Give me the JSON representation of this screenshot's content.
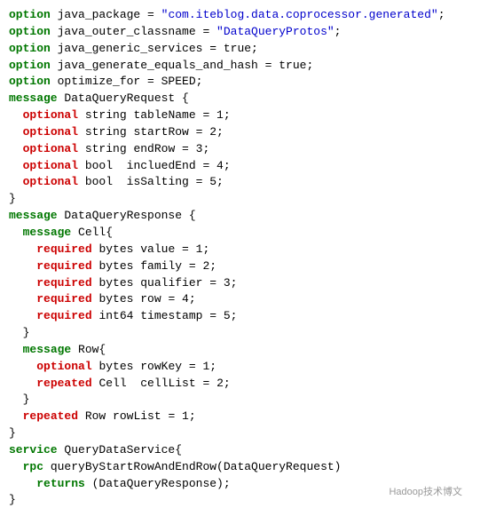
{
  "code": {
    "lines": [
      {
        "parts": [
          {
            "type": "kw-option",
            "text": "option"
          },
          {
            "type": "plain",
            "text": " java_package = "
          },
          {
            "type": "str",
            "text": "\"com.iteblog.data.coprocessor.generated\""
          },
          {
            "type": "plain",
            "text": ";"
          }
        ]
      },
      {
        "parts": [
          {
            "type": "kw-option",
            "text": "option"
          },
          {
            "type": "plain",
            "text": " java_outer_classname = "
          },
          {
            "type": "str",
            "text": "\"DataQueryProtos\""
          },
          {
            "type": "plain",
            "text": ";"
          }
        ]
      },
      {
        "parts": [
          {
            "type": "kw-option",
            "text": "option"
          },
          {
            "type": "plain",
            "text": " java_generic_services = true;"
          }
        ]
      },
      {
        "parts": [
          {
            "type": "kw-option",
            "text": "option"
          },
          {
            "type": "plain",
            "text": " java_generate_equals_and_hash = true;"
          }
        ]
      },
      {
        "parts": [
          {
            "type": "kw-option",
            "text": "option"
          },
          {
            "type": "plain",
            "text": " optimize_for = SPEED;"
          }
        ]
      },
      {
        "parts": [
          {
            "type": "kw-message",
            "text": "message"
          },
          {
            "type": "plain",
            "text": " DataQueryRequest {"
          }
        ]
      },
      {
        "parts": [
          {
            "type": "plain",
            "text": "  "
          },
          {
            "type": "kw-optional",
            "text": "optional"
          },
          {
            "type": "plain",
            "text": " string tableName = 1;"
          }
        ]
      },
      {
        "parts": [
          {
            "type": "plain",
            "text": "  "
          },
          {
            "type": "kw-optional",
            "text": "optional"
          },
          {
            "type": "plain",
            "text": " string startRow = 2;"
          }
        ]
      },
      {
        "parts": [
          {
            "type": "plain",
            "text": "  "
          },
          {
            "type": "kw-optional",
            "text": "optional"
          },
          {
            "type": "plain",
            "text": " string endRow = 3;"
          }
        ]
      },
      {
        "parts": [
          {
            "type": "plain",
            "text": "  "
          },
          {
            "type": "kw-optional",
            "text": "optional"
          },
          {
            "type": "plain",
            "text": " bool  incluedEnd = 4;"
          }
        ]
      },
      {
        "parts": [
          {
            "type": "plain",
            "text": "  "
          },
          {
            "type": "kw-optional",
            "text": "optional"
          },
          {
            "type": "plain",
            "text": " bool  isSalting = 5;"
          }
        ]
      },
      {
        "parts": [
          {
            "type": "plain",
            "text": "}"
          }
        ]
      },
      {
        "parts": [
          {
            "type": "kw-message",
            "text": "message"
          },
          {
            "type": "plain",
            "text": " DataQueryResponse {"
          }
        ]
      },
      {
        "parts": [
          {
            "type": "plain",
            "text": "  "
          },
          {
            "type": "kw-message",
            "text": "message"
          },
          {
            "type": "plain",
            "text": " Cell{"
          }
        ]
      },
      {
        "parts": [
          {
            "type": "plain",
            "text": "    "
          },
          {
            "type": "kw-required",
            "text": "required"
          },
          {
            "type": "plain",
            "text": " bytes value = 1;"
          }
        ]
      },
      {
        "parts": [
          {
            "type": "plain",
            "text": "    "
          },
          {
            "type": "kw-required",
            "text": "required"
          },
          {
            "type": "plain",
            "text": " bytes family = 2;"
          }
        ]
      },
      {
        "parts": [
          {
            "type": "plain",
            "text": "    "
          },
          {
            "type": "kw-required",
            "text": "required"
          },
          {
            "type": "plain",
            "text": " bytes qualifier = 3;"
          }
        ]
      },
      {
        "parts": [
          {
            "type": "plain",
            "text": "    "
          },
          {
            "type": "kw-required",
            "text": "required"
          },
          {
            "type": "plain",
            "text": " bytes row = 4;"
          }
        ]
      },
      {
        "parts": [
          {
            "type": "plain",
            "text": "    "
          },
          {
            "type": "kw-required",
            "text": "required"
          },
          {
            "type": "plain",
            "text": " int64 timestamp = 5;"
          }
        ]
      },
      {
        "parts": [
          {
            "type": "plain",
            "text": "  }"
          }
        ]
      },
      {
        "parts": [
          {
            "type": "plain",
            "text": "  "
          },
          {
            "type": "kw-message",
            "text": "message"
          },
          {
            "type": "plain",
            "text": " Row{"
          }
        ]
      },
      {
        "parts": [
          {
            "type": "plain",
            "text": "    "
          },
          {
            "type": "kw-optional",
            "text": "optional"
          },
          {
            "type": "plain",
            "text": " bytes rowKey = 1;"
          }
        ]
      },
      {
        "parts": [
          {
            "type": "plain",
            "text": "    "
          },
          {
            "type": "kw-repeated",
            "text": "repeated"
          },
          {
            "type": "plain",
            "text": " Cell  cellList = 2;"
          }
        ]
      },
      {
        "parts": [
          {
            "type": "plain",
            "text": "  }"
          }
        ]
      },
      {
        "parts": [
          {
            "type": "plain",
            "text": "  "
          },
          {
            "type": "kw-repeated",
            "text": "repeated"
          },
          {
            "type": "plain",
            "text": " Row rowList = 1;"
          }
        ]
      },
      {
        "parts": [
          {
            "type": "plain",
            "text": "}"
          }
        ]
      },
      {
        "parts": [
          {
            "type": "kw-service",
            "text": "service"
          },
          {
            "type": "plain",
            "text": " QueryDataService{"
          }
        ]
      },
      {
        "parts": [
          {
            "type": "plain",
            "text": "  "
          },
          {
            "type": "kw-rpc",
            "text": "rpc"
          },
          {
            "type": "plain",
            "text": " queryByStartRowAndEndRow(DataQueryRequest)"
          }
        ]
      },
      {
        "parts": [
          {
            "type": "plain",
            "text": "    "
          },
          {
            "type": "kw-returns",
            "text": "returns"
          },
          {
            "type": "plain",
            "text": " (DataQueryResponse);"
          }
        ]
      },
      {
        "parts": [
          {
            "type": "plain",
            "text": "}"
          }
        ]
      }
    ]
  },
  "watermark": "Hadoop技术博文"
}
